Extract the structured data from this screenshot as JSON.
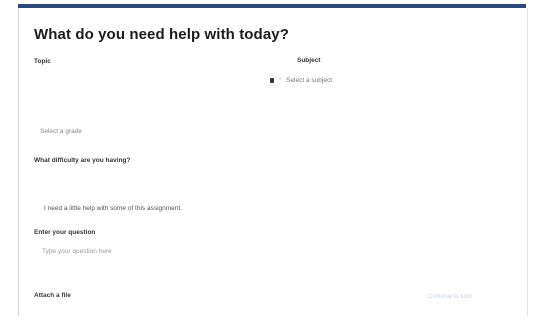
{
  "form": {
    "title": "What do you need help with today?",
    "topic_label": "Topic",
    "subject_label": "Subject",
    "subject_icon": "•",
    "subject_placeholder": "Select a subject",
    "grade_placeholder": "Select a grade",
    "question_prompt": "What difficulty are you having?",
    "option_text": "I need a little help with some of this assignment.",
    "question_label": "Enter your question",
    "question_placeholder": "Type your question here",
    "attach_label": "Attach a file",
    "right_hint": "Continue to tutor"
  },
  "colors": {
    "accent_bar": "#2f4a78"
  }
}
